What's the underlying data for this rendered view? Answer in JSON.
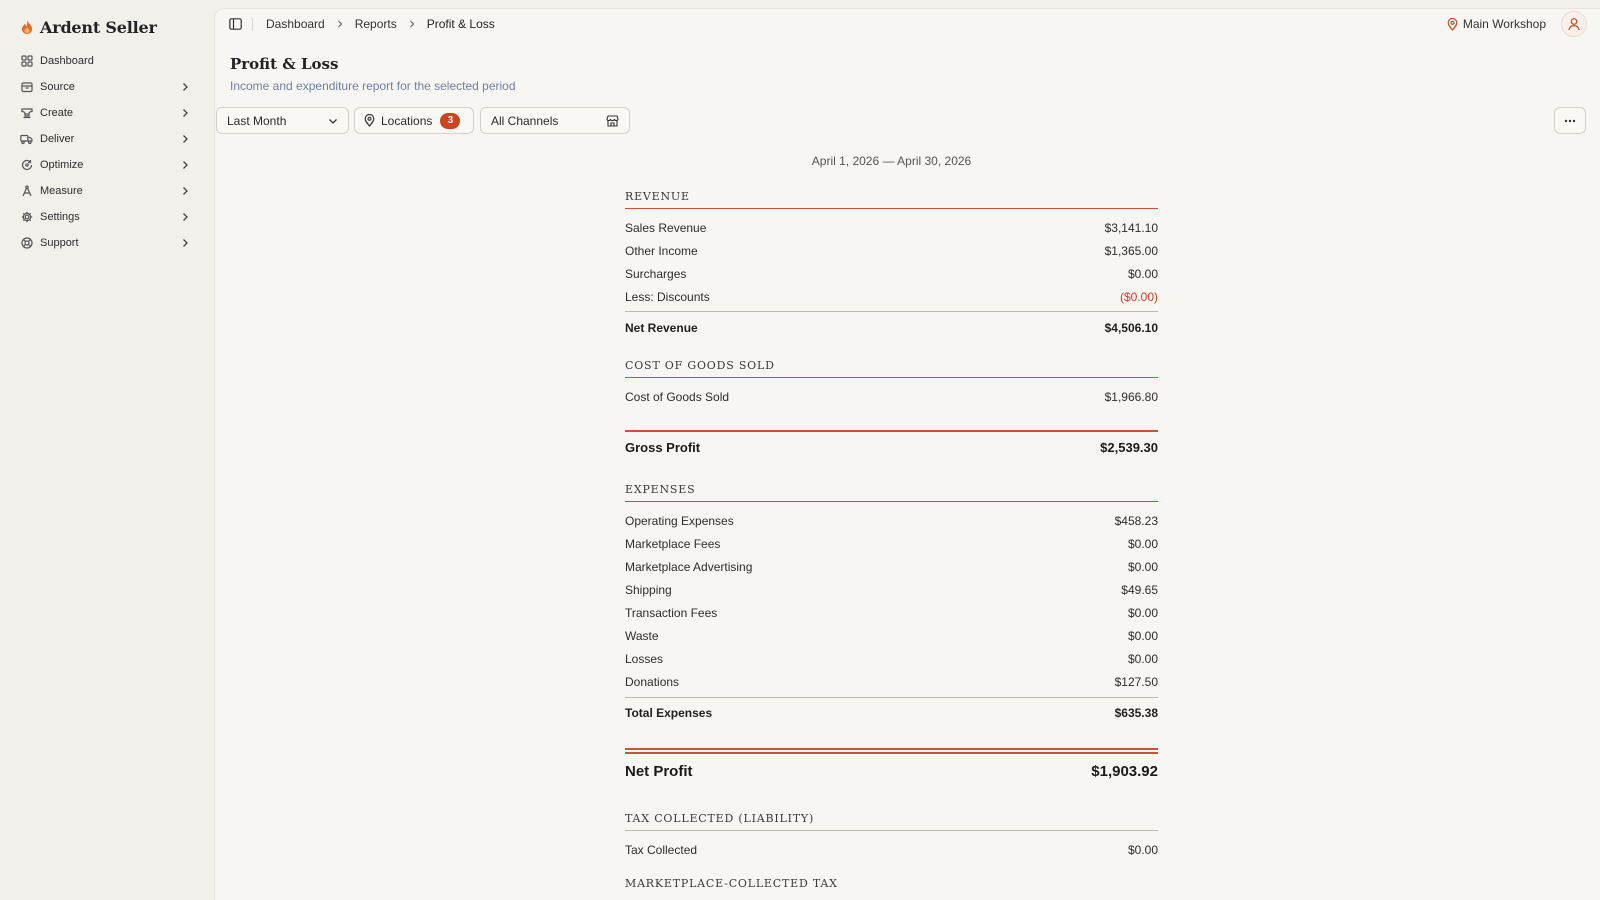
{
  "app": {
    "name": "Ardent Seller"
  },
  "sidebar": {
    "items": [
      {
        "label": "Dashboard",
        "icon": "grid-icon",
        "has_children": false
      },
      {
        "label": "Source",
        "icon": "box-icon",
        "has_children": true
      },
      {
        "label": "Create",
        "icon": "anvil-icon",
        "has_children": true
      },
      {
        "label": "Deliver",
        "icon": "truck-icon",
        "has_children": true
      },
      {
        "label": "Optimize",
        "icon": "refresh-icon",
        "has_children": true
      },
      {
        "label": "Measure",
        "icon": "compass-icon",
        "has_children": true
      },
      {
        "label": "Settings",
        "icon": "gear-icon",
        "has_children": true
      },
      {
        "label": "Support",
        "icon": "lifebuoy-icon",
        "has_children": true
      }
    ]
  },
  "breadcrumb": [
    "Dashboard",
    "Reports",
    "Profit & Loss"
  ],
  "header": {
    "workshop": "Main Workshop"
  },
  "page": {
    "title": "Profit & Loss",
    "subtitle": "Income and expenditure report for the selected period"
  },
  "filters": {
    "period": "Last Month",
    "locations_label": "Locations",
    "locations_count": "3",
    "channels": "All Channels"
  },
  "report": {
    "period": "April 1, 2026 — April 30, 2026",
    "revenue": {
      "heading": "REVENUE",
      "rows": [
        {
          "label": "Sales Revenue",
          "value": "$3,141.10"
        },
        {
          "label": "Other Income",
          "value": "$1,365.00"
        },
        {
          "label": "Surcharges",
          "value": "$0.00"
        },
        {
          "label": "Less: Discounts",
          "value": "($0.00)"
        }
      ],
      "total_label": "Net Revenue",
      "total_value": "$4,506.10"
    },
    "cogs": {
      "heading": "COST OF GOODS SOLD",
      "rows": [
        {
          "label": "Cost of Goods Sold",
          "value": "$1,966.80"
        }
      ]
    },
    "gross_profit": {
      "label": "Gross Profit",
      "value": "$2,539.30"
    },
    "expenses": {
      "heading": "EXPENSES",
      "rows": [
        {
          "label": "Operating Expenses",
          "value": "$458.23"
        },
        {
          "label": "Marketplace Fees",
          "value": "$0.00"
        },
        {
          "label": "Marketplace Advertising",
          "value": "$0.00"
        },
        {
          "label": "Shipping",
          "value": "$49.65"
        },
        {
          "label": "Transaction Fees",
          "value": "$0.00"
        },
        {
          "label": "Waste",
          "value": "$0.00"
        },
        {
          "label": "Losses",
          "value": "$0.00"
        },
        {
          "label": "Donations",
          "value": "$127.50"
        }
      ],
      "total_label": "Total Expenses",
      "total_value": "$635.38"
    },
    "net_profit": {
      "label": "Net Profit",
      "value": "$1,903.92"
    },
    "tax": {
      "heading": "TAX COLLECTED (LIABILITY)",
      "rows": [
        {
          "label": "Tax Collected",
          "value": "$0.00"
        }
      ]
    },
    "marketplace_tax": {
      "heading": "MARKETPLACE-COLLECTED TAX"
    }
  },
  "colors": {
    "accent": "#c9441f",
    "link": "#6e7ea8",
    "background": "#f1f0eb"
  }
}
